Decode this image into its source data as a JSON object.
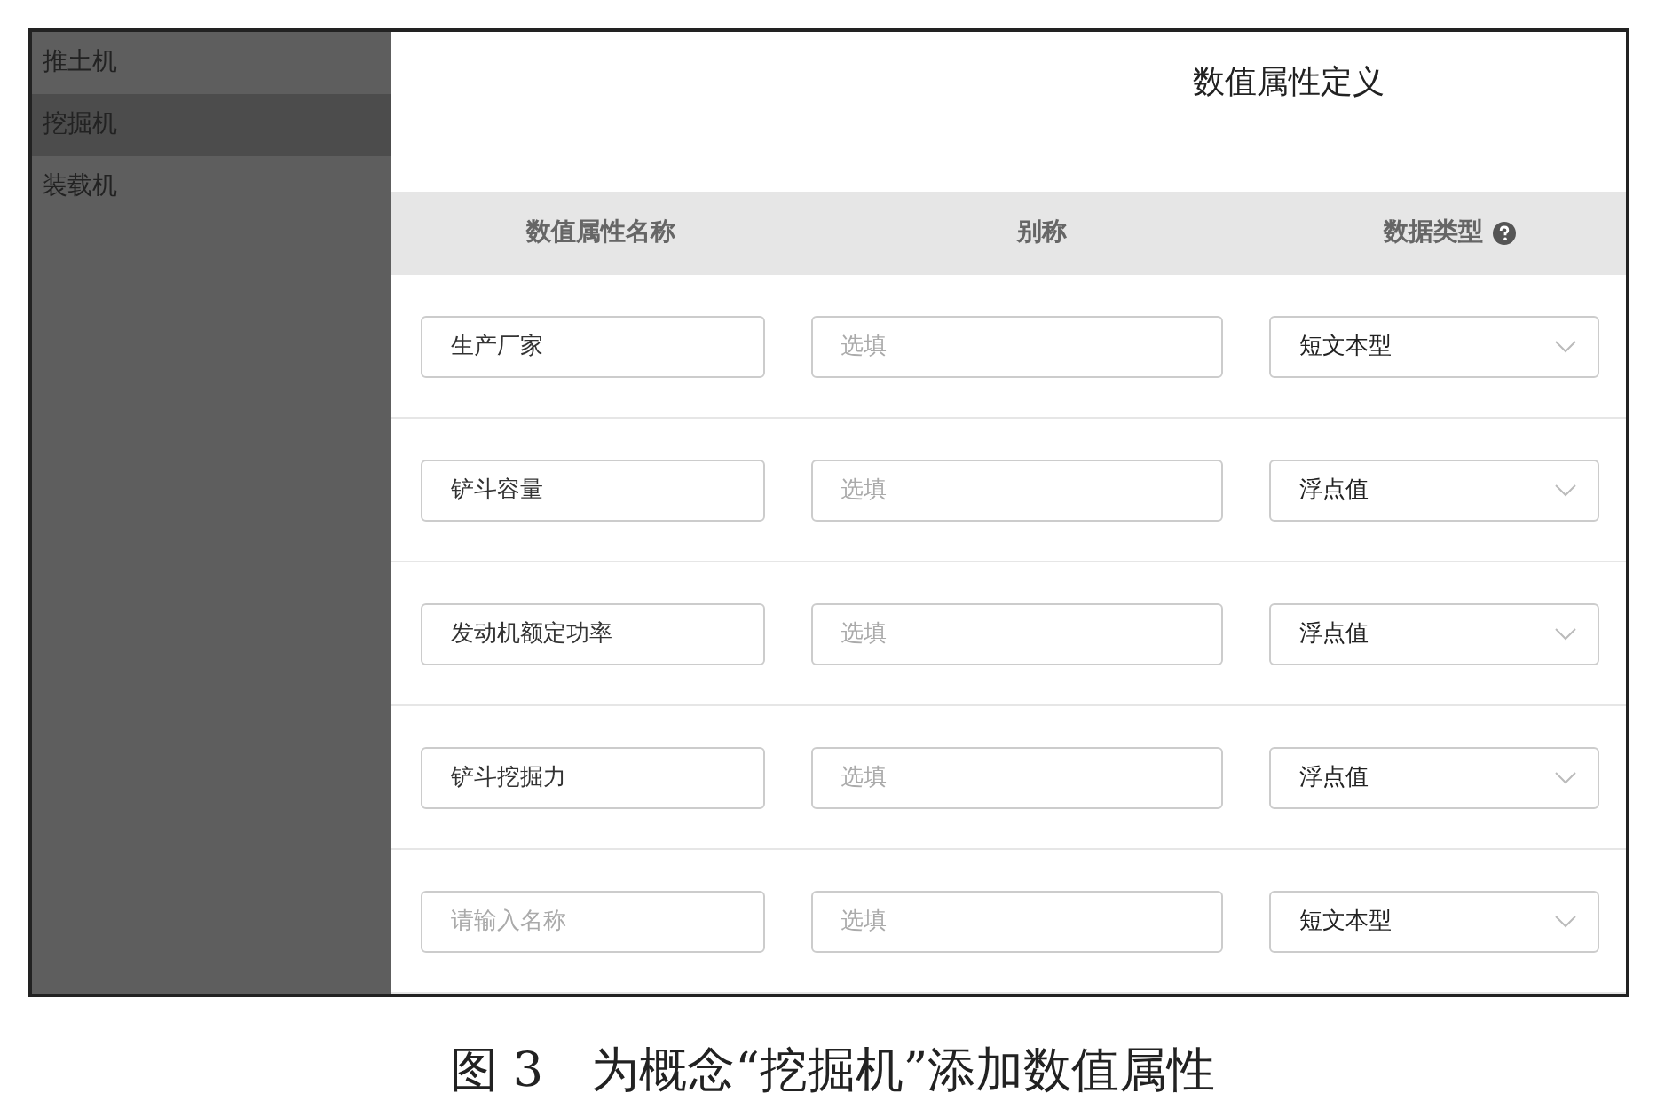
{
  "sidebar": {
    "items": [
      {
        "label": "推土机",
        "selected": false
      },
      {
        "label": "挖掘机",
        "selected": true
      },
      {
        "label": "装载机",
        "selected": false
      }
    ]
  },
  "title": "数值属性定义",
  "table": {
    "columns": [
      "数值属性名称",
      "别称",
      "数据类型"
    ],
    "rows": [
      {
        "name": {
          "value": "生产厂家"
        },
        "alias": {
          "placeholder": "选填"
        },
        "type": "短文本型"
      },
      {
        "name": {
          "value": "铲斗容量"
        },
        "alias": {
          "placeholder": "选填"
        },
        "type": "浮点值"
      },
      {
        "name": {
          "value": "发动机额定功率"
        },
        "alias": {
          "placeholder": "选填"
        },
        "type": "浮点值"
      },
      {
        "name": {
          "value": "铲斗挖掘力"
        },
        "alias": {
          "placeholder": "选填"
        },
        "type": "浮点值"
      },
      {
        "name": {
          "placeholder": "请输入名称"
        },
        "alias": {
          "placeholder": "选填"
        },
        "type": "短文本型"
      }
    ]
  },
  "caption": "图 3　为概念“挖掘机”添加数值属性"
}
